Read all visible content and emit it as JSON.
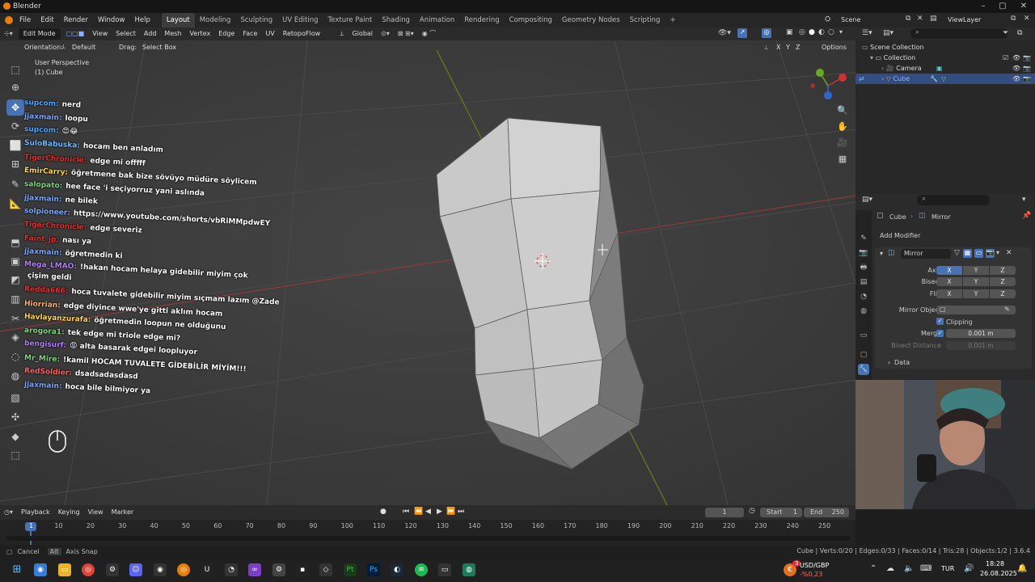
{
  "app": {
    "title": "Blender",
    "menu": [
      "File",
      "Edit",
      "Render",
      "Window",
      "Help"
    ],
    "workspaces": [
      "Layout",
      "Modeling",
      "Sculpting",
      "UV Editing",
      "Texture Paint",
      "Shading",
      "Animation",
      "Rendering",
      "Compositing",
      "Geometry Nodes",
      "Scripting",
      "+"
    ],
    "scene": "Scene",
    "view_layer": "ViewLayer"
  },
  "viewport_header": {
    "mode": "Edit Mode",
    "menus": [
      "View",
      "Select",
      "Add",
      "Mesh",
      "Vertex",
      "Edge",
      "Face",
      "UV",
      "RetopoFlow"
    ],
    "transform": "Global",
    "orientation_label": "Orientation:",
    "orientation_value": "Default",
    "drag_label": "Drag:",
    "drag_value": "Select Box",
    "axes": [
      "X",
      "Y",
      "Z"
    ],
    "options": "Options"
  },
  "viewport": {
    "perspective": "User Perspective",
    "object": "(1) Cube"
  },
  "chat": [
    {
      "user": "supcom:",
      "msg": "nerd",
      "color": "#4da6ff"
    },
    {
      "user": "jjaxmain:",
      "msg": "loopu",
      "color": "#7aa6ff"
    },
    {
      "user": "supcom:",
      "msg": "😍😂",
      "color": "#4da6ff"
    },
    {
      "user": "SuloBabuska:",
      "msg": "hocam ben anladım",
      "color": "#6cb8ff"
    },
    {
      "user": "TigerChronicle:",
      "msg": "edge mi offfff",
      "color": "#e03030"
    },
    {
      "user": "EmirCarry:",
      "msg": "öğretmene bak bize sövüyo müdüre söylicem",
      "color": "#ffd34d"
    },
    {
      "user": "salopato:",
      "msg": "hee face 'i seçiyorruz yani aslında",
      "color": "#7fd37f"
    },
    {
      "user": "jjaxmain:",
      "msg": "ne bilek",
      "color": "#7aa6ff"
    },
    {
      "user": "solpioneer:",
      "msg": "https://www.youtube.com/shorts/vbRiMMpdwEY",
      "color": "#7aa6ff"
    },
    {
      "user": "TigerChronicle:",
      "msg": "edge severiz",
      "color": "#e03030"
    },
    {
      "user": "Faint_jp:",
      "msg": "nası ya",
      "color": "#e03030"
    },
    {
      "user": "jjaxmain:",
      "msg": "öğretmedin ki",
      "color": "#7aa6ff"
    },
    {
      "user": "Mega_LMAO:",
      "msg": "!hakan hocam helaya gidebilir miyim çok",
      "color": "#b47cff"
    },
    {
      "user": "",
      "msg": "çişim geldi",
      "color": "#ffffff"
    },
    {
      "user": "Redda666:",
      "msg": "hoca tuvalete gidebilir miyim sıçmam lazım @Zade",
      "color": "#e03030"
    },
    {
      "user": "Hiorrian:",
      "msg": "edge diyince wwe'ye gitti aklım hocam",
      "color": "#ffb066"
    },
    {
      "user": "Havlayanzurafa:",
      "msg": "öğretmedin loopun ne olduğunu",
      "color": "#ffd34d"
    },
    {
      "user": "arogora1:",
      "msg": "tek edge mi triole edge mi?",
      "color": "#7fd37f"
    },
    {
      "user": "bengisurf:",
      "msg": "😡 alta basarak edgei loopluyor",
      "color": "#b47cff"
    },
    {
      "user": "Mr_Mire:",
      "msg": "!kamil HOCAM TUVALETE GİDEBİLİR MİYİM!!!",
      "color": "#7fd37f"
    },
    {
      "user": "RedSoldier:",
      "msg": "dsadsadasdasd",
      "color": "#ff6060"
    },
    {
      "user": "jjaxmain:",
      "msg": "hoca bile bilmiyor ya",
      "color": "#7aa6ff"
    }
  ],
  "outliner": {
    "root": "Scene Collection",
    "collection": "Collection",
    "items": [
      "Camera",
      "Cube"
    ]
  },
  "properties": {
    "breadcrumb_object": "Cube",
    "breadcrumb_modifier": "Mirror",
    "add_modifier": "Add Modifier",
    "modifier_name": "Mirror",
    "axis_label": "Axis",
    "bisect_label": "Bisect",
    "flip_label": "Flip",
    "xyz": [
      "X",
      "Y",
      "Z"
    ],
    "mirror_object_label": "Mirror Object",
    "clipping_label": "Clipping",
    "merge_label": "Merge",
    "merge_value": "0.001 m",
    "bisect_distance_label": "Bisect Distance",
    "bisect_distance_value": "0.001 m",
    "data_label": "Data"
  },
  "timeline": {
    "menus": [
      "Playback",
      "Keying",
      "View",
      "Marker"
    ],
    "current_frame": "1",
    "start_label": "Start",
    "start": "1",
    "end_label": "End",
    "end": "250",
    "ticks": [
      "1",
      "10",
      "20",
      "30",
      "40",
      "50",
      "60",
      "70",
      "80",
      "90",
      "100",
      "110",
      "120",
      "130",
      "140",
      "150",
      "160",
      "170",
      "180",
      "190",
      "200",
      "210",
      "220",
      "230",
      "240",
      "250"
    ]
  },
  "statusbar": {
    "cancel": "Cancel",
    "alt": "Alt",
    "axis_snap": "Axis Snap",
    "stats": "Cube | Verts:0/20 | Edges:0/33 | Faces:0/14 | Tris:28 | Objects:1/2 | 3.6.4"
  },
  "taskbar": {
    "ticker": "USD/GBP",
    "ticker_change": "-%0,23",
    "badge": "3",
    "lang": "TUR",
    "time": "18:28",
    "date": "26.08.2025"
  }
}
